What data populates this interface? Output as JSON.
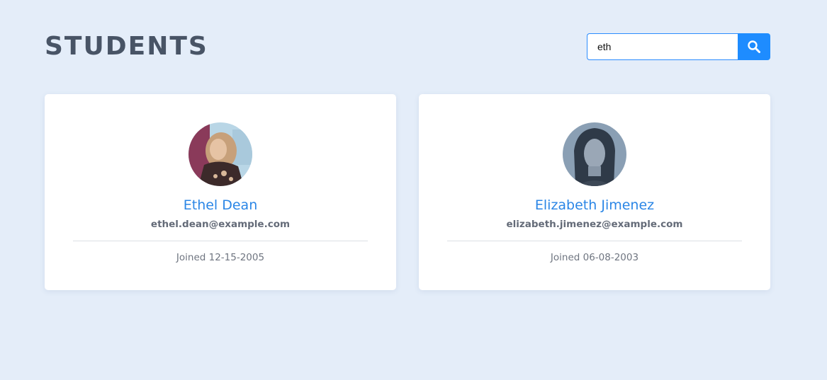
{
  "page": {
    "title": "STUDENTS"
  },
  "search": {
    "value": "eth",
    "button_icon": "search-icon"
  },
  "students": [
    {
      "name": "Ethel Dean",
      "email": "ethel.dean@example.com",
      "joined": "Joined 12-15-2005"
    },
    {
      "name": "Elizabeth Jimenez",
      "email": "elizabeth.jimenez@example.com",
      "joined": "Joined 06-08-2003"
    }
  ],
  "colors": {
    "background": "#e4edf9",
    "accent": "#1e8cff",
    "name": "#2b86e6",
    "title": "#485466"
  }
}
